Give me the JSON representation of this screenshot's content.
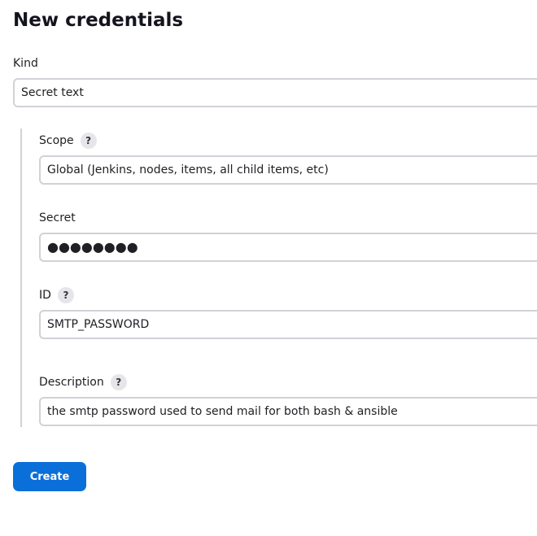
{
  "page": {
    "title": "New credentials"
  },
  "kind": {
    "label": "Kind",
    "value": "Secret text"
  },
  "scope": {
    "label": "Scope",
    "help": "?",
    "value": "Global (Jenkins, nodes, items, all child items, etc)"
  },
  "secret": {
    "label": "Secret",
    "value": "●●●●●●●●"
  },
  "id": {
    "label": "ID",
    "help": "?",
    "value": "SMTP_PASSWORD"
  },
  "description": {
    "label": "Description",
    "help": "?",
    "value": "the smtp password used to send mail for both bash & ansible"
  },
  "actions": {
    "create_label": "Create"
  },
  "colors": {
    "primary_button": "#0b6fd9",
    "border": "#d1d1d8",
    "help_bg": "#e6e6ea"
  }
}
